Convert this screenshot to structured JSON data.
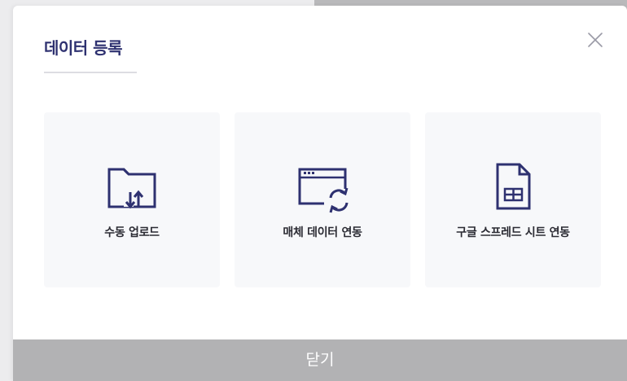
{
  "modal": {
    "title": "데이터 등록",
    "close_icon": "close-icon"
  },
  "cards": [
    {
      "label": "수동 업로드",
      "icon": "folder-upload-icon"
    },
    {
      "label": "매체 데이터 연동",
      "icon": "window-sync-icon"
    },
    {
      "label": "구글 스프레드 시트 연동",
      "icon": "spreadsheet-icon"
    }
  ],
  "footer": {
    "close_label": "닫기"
  },
  "colors": {
    "accent": "#2e3170",
    "card_bg": "#f7f8fa",
    "footer_bg": "#b2b2b4",
    "close_icon": "#9a9aa6"
  }
}
